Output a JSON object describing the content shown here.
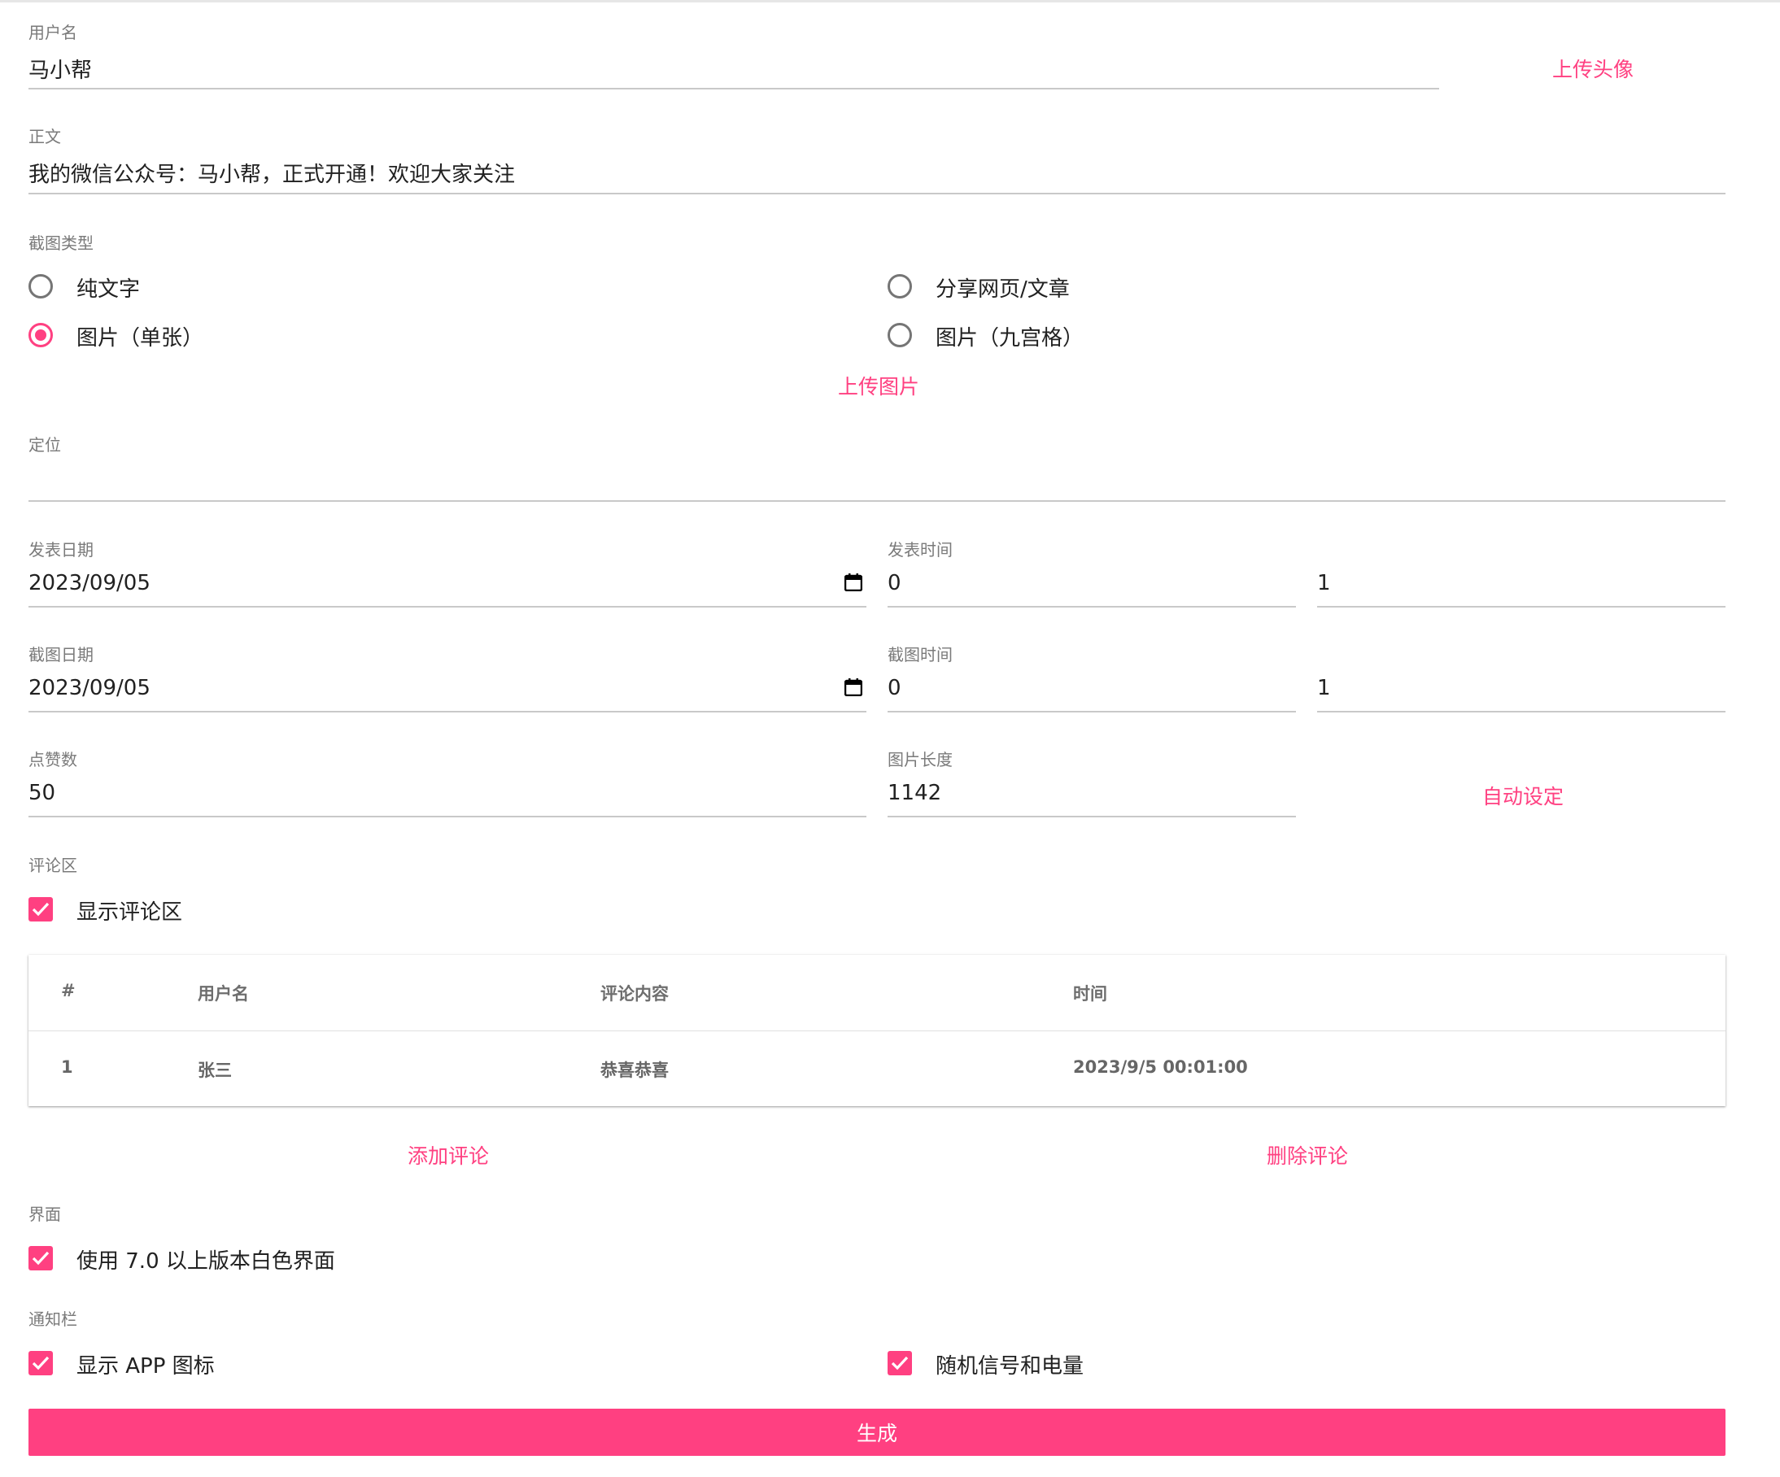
{
  "form": {
    "username": {
      "label": "用户名",
      "value": "马小帮"
    },
    "upload_avatar": "上传头像",
    "body": {
      "label": "正文",
      "value": "我的微信公众号：马小帮，正式开通！欢迎大家关注"
    },
    "screenshot_type": {
      "label": "截图类型",
      "options": [
        "纯文字",
        "分享网页/文章",
        "图片（单张）",
        "图片（九宫格）"
      ],
      "selected": "图片（单张）"
    },
    "upload_image": "上传图片",
    "location": {
      "label": "定位",
      "value": ""
    },
    "post_date": {
      "label": "发表日期",
      "value": "2023/09/05"
    },
    "post_time": {
      "label": "发表时间",
      "hour": "0",
      "minute": "1"
    },
    "capture_date": {
      "label": "截图日期",
      "value": "2023/09/05"
    },
    "capture_time": {
      "label": "截图时间",
      "hour": "0",
      "minute": "1"
    },
    "likes": {
      "label": "点赞数",
      "value": "50"
    },
    "image_length": {
      "label": "图片长度",
      "value": "1142"
    },
    "auto_set": "自动设定",
    "comments": {
      "label": "评论区",
      "show_label": "显示评论区",
      "show_checked": true,
      "table": {
        "headers": [
          "#",
          "用户名",
          "评论内容",
          "时间"
        ],
        "rows": [
          [
            "1",
            "张三",
            "恭喜恭喜",
            "2023/9/5 00:01:00"
          ]
        ]
      },
      "add": "添加评论",
      "delete": "删除评论"
    },
    "ui": {
      "label": "界面",
      "option": "使用 7.0 以上版本白色界面",
      "checked": true
    },
    "notification": {
      "label": "通知栏",
      "show_app_icon": "显示 APP 图标",
      "random_signal": "随机信号和电量"
    },
    "generate": "生成"
  },
  "colors": {
    "accent": "#ff4081",
    "label": "#7a7a7a",
    "underline": "#c9c9c9"
  }
}
